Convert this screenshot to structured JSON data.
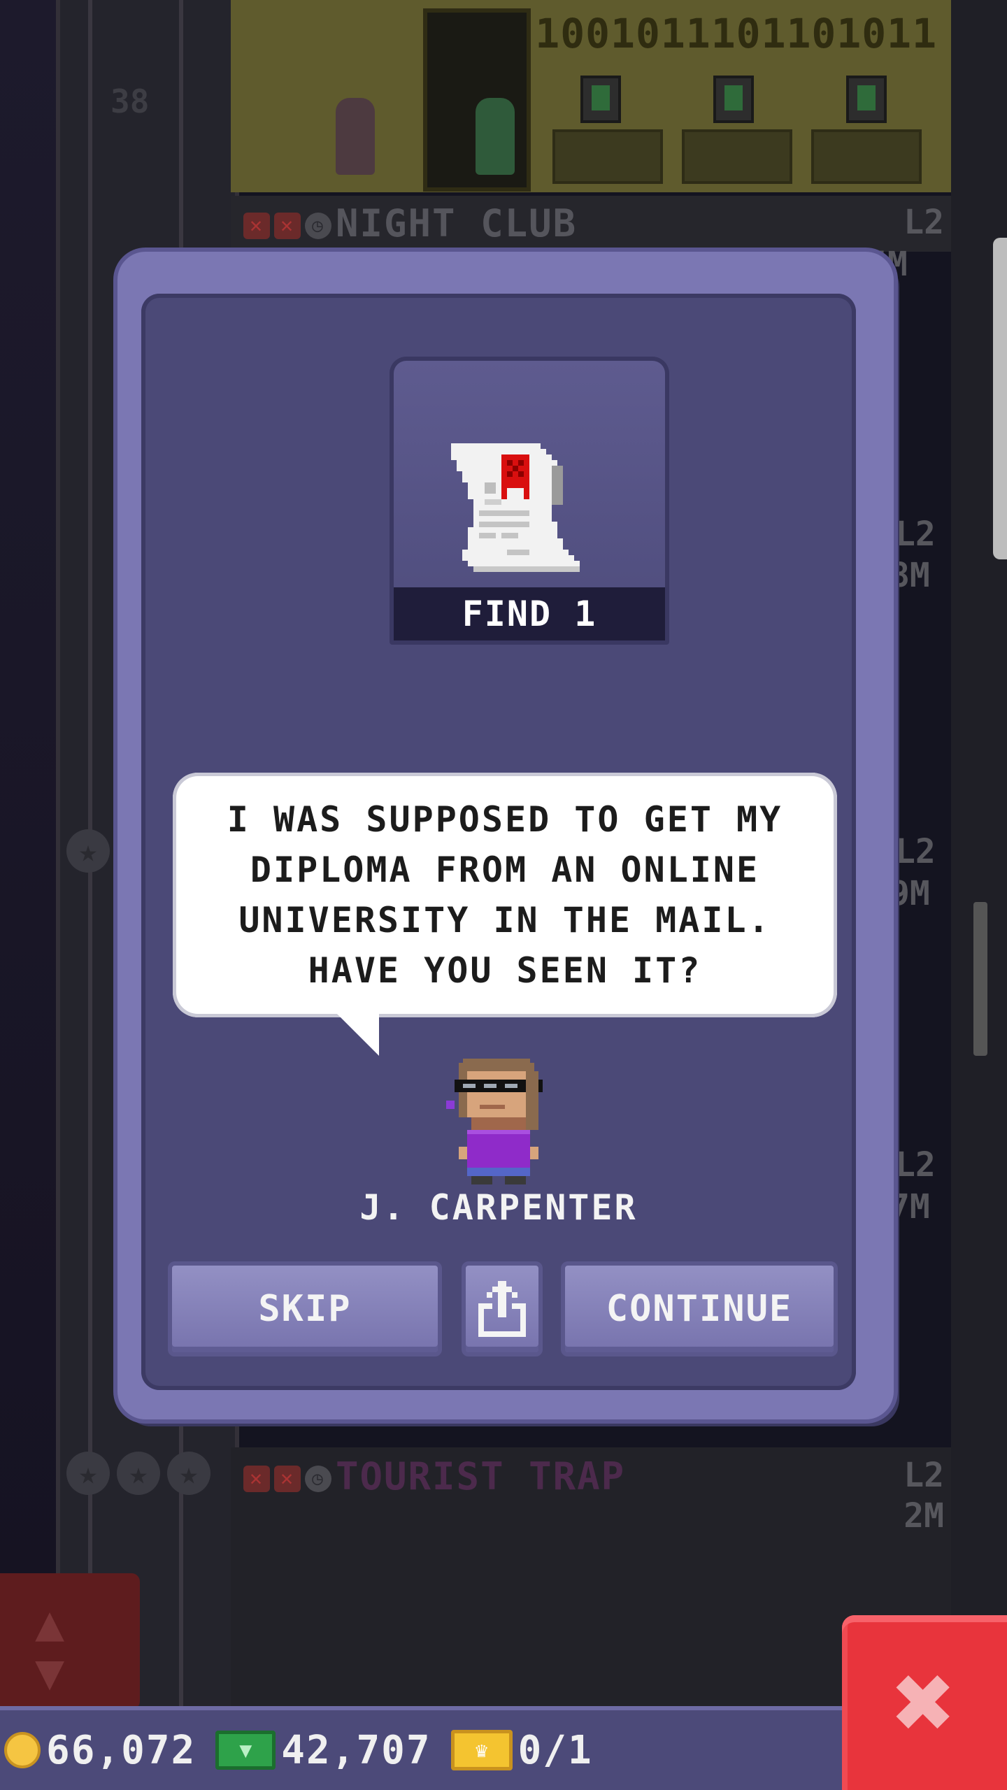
{
  "background": {
    "top_floor": {
      "binary": "1001011101101011",
      "floor_number": "38"
    },
    "night_club": {
      "name": "NIGHT CLUB",
      "level": "L2",
      "price": "5M"
    },
    "floor_b": {
      "level": "L2",
      "price": "8M"
    },
    "floor_c": {
      "level": "L2",
      "price": "9M"
    },
    "floor_d": {
      "level": "L2",
      "price": "7M"
    },
    "tourist_trap": {
      "name": "TOURIST TRAP",
      "level": "L2",
      "price": "2M"
    }
  },
  "modal": {
    "item": {
      "icon": "diploma-scroll-icon",
      "find_label": "FIND 1"
    },
    "speech": "I WAS SUPPOSED TO GET MY DIPLOMA FROM AN ONLINE UNIVERSITY IN THE MAIL. HAVE YOU SEEN IT?",
    "character_name": "J. CARPENTER",
    "buttons": {
      "skip": "SKIP",
      "share_icon": "share-icon",
      "continue": "CONTINUE"
    }
  },
  "status_bar": {
    "coins": "66,072",
    "bux": "42,707",
    "tickets": "0/1"
  },
  "colors": {
    "modal_frame": "#7b77b3",
    "modal_body": "#4b4977",
    "button": "#8581bb",
    "close_button": "#e8343c"
  }
}
